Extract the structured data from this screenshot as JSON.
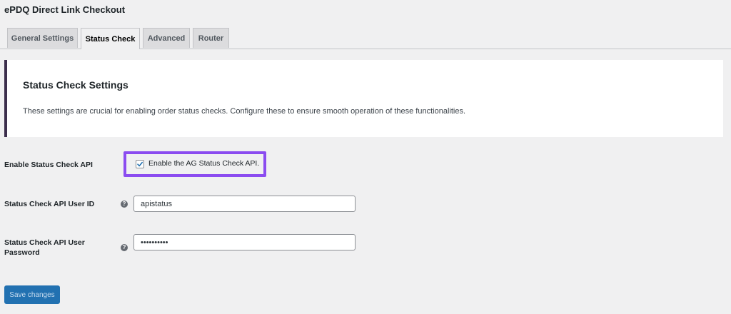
{
  "page": {
    "title": "ePDQ Direct Link Checkout"
  },
  "tabs": [
    {
      "label": "General Settings",
      "active": false
    },
    {
      "label": "Status Check",
      "active": true
    },
    {
      "label": "Advanced",
      "active": false
    },
    {
      "label": "Router",
      "active": false
    }
  ],
  "notice": {
    "heading": "Status Check Settings",
    "description": "These settings are crucial for enabling order status checks. Configure these to ensure smooth operation of these functionalities."
  },
  "settings": {
    "enable_api": {
      "label": "Enable Status Check API",
      "checkbox_label": "Enable the AG Status Check API.",
      "checked": true
    },
    "user_id": {
      "label": "Status Check API User ID",
      "value": "apistatus"
    },
    "password": {
      "label_line1": "Status Check API User",
      "label_line2": "Password",
      "value": "••••••••••"
    }
  },
  "help_icon_glyph": "?",
  "actions": {
    "save_label": "Save changes"
  },
  "colors": {
    "accent": "#2271b1",
    "highlight": "#8b4cf0",
    "notice_border": "#3c2e4c"
  }
}
